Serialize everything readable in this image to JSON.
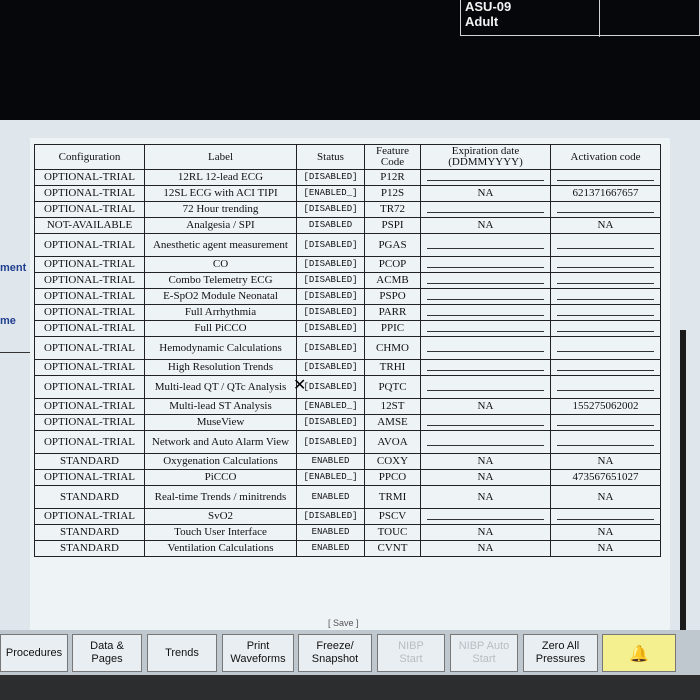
{
  "patient": {
    "bed": "ASU-09",
    "category": "Adult"
  },
  "left_panel": {
    "label_1": "ment",
    "label_2": "me"
  },
  "table": {
    "headers": [
      "Configuration",
      "Label",
      "Status",
      "Feature Code",
      "Expiration date (DDMMYYYY)",
      "Activation code"
    ],
    "rows": [
      {
        "config": "OPTIONAL-TRIAL",
        "label": "12RL 12-lead ECG",
        "status": "[DISABLED]",
        "code": "P12R",
        "exp": "",
        "act": ""
      },
      {
        "config": "OPTIONAL-TRIAL",
        "label": "12SL ECG with ACI TIPI",
        "status": "[ENABLED_]",
        "code": "P12S",
        "exp": "NA",
        "act": "621371667657"
      },
      {
        "config": "OPTIONAL-TRIAL",
        "label": "72 Hour trending",
        "status": "[DISABLED]",
        "code": "TR72",
        "exp": "",
        "act": ""
      },
      {
        "config": "NOT-AVAILABLE",
        "label": "Analgesia / SPI",
        "status": "DISABLED",
        "code": "PSPI",
        "exp": "NA",
        "act": "NA"
      },
      {
        "config": "OPTIONAL-TRIAL",
        "label": "Anesthetic agent measurement",
        "status": "[DISABLED]",
        "code": "PGAS",
        "exp": "",
        "act": ""
      },
      {
        "config": "OPTIONAL-TRIAL",
        "label": "CO",
        "status": "[DISABLED]",
        "code": "PCOP",
        "exp": "",
        "act": ""
      },
      {
        "config": "OPTIONAL-TRIAL",
        "label": "Combo Telemetry ECG",
        "status": "[DISABLED]",
        "code": "ACMB",
        "exp": "",
        "act": ""
      },
      {
        "config": "OPTIONAL-TRIAL",
        "label": "E-SpO2 Module Neonatal",
        "status": "[DISABLED]",
        "code": "PSPO",
        "exp": "",
        "act": ""
      },
      {
        "config": "OPTIONAL-TRIAL",
        "label": "Full Arrhythmia",
        "status": "[DISABLED]",
        "code": "PARR",
        "exp": "",
        "act": ""
      },
      {
        "config": "OPTIONAL-TRIAL",
        "label": "Full PiCCO",
        "status": "[DISABLED]",
        "code": "PPIC",
        "exp": "",
        "act": ""
      },
      {
        "config": "OPTIONAL-TRIAL",
        "label": "Hemodynamic Calculations",
        "status": "[DISABLED]",
        "code": "CHMO",
        "exp": "",
        "act": ""
      },
      {
        "config": "OPTIONAL-TRIAL",
        "label": "High Resolution Trends",
        "status": "[DISABLED]",
        "code": "TRHI",
        "exp": "",
        "act": ""
      },
      {
        "config": "OPTIONAL-TRIAL",
        "label": "Multi-lead QT / QTc Analysis",
        "status": "[DISABLED]",
        "code": "PQTC",
        "exp": "",
        "act": ""
      },
      {
        "config": "OPTIONAL-TRIAL",
        "label": "Multi-lead ST Analysis",
        "status": "[ENABLED_]",
        "code": "12ST",
        "exp": "NA",
        "act": "155275062002"
      },
      {
        "config": "OPTIONAL-TRIAL",
        "label": "MuseView",
        "status": "[DISABLED]",
        "code": "AMSE",
        "exp": "",
        "act": ""
      },
      {
        "config": "OPTIONAL-TRIAL",
        "label": "Network and Auto Alarm View",
        "status": "[DISABLED]",
        "code": "AVOA",
        "exp": "",
        "act": ""
      },
      {
        "config": "STANDARD",
        "label": "Oxygenation Calculations",
        "status": "ENABLED",
        "code": "COXY",
        "exp": "NA",
        "act": "NA"
      },
      {
        "config": "OPTIONAL-TRIAL",
        "label": "PiCCO",
        "status": "[ENABLED_]",
        "code": "PPCO",
        "exp": "NA",
        "act": "473567651027"
      },
      {
        "config": "STANDARD",
        "label": "Real-time Trends / minitrends",
        "status": "ENABLED",
        "code": "TRMI",
        "exp": "NA",
        "act": "NA"
      },
      {
        "config": "OPTIONAL-TRIAL",
        "label": "SvO2",
        "status": "[DISABLED]",
        "code": "PSCV",
        "exp": "",
        "act": ""
      },
      {
        "config": "STANDARD",
        "label": "Touch User Interface",
        "status": "ENABLED",
        "code": "TOUC",
        "exp": "NA",
        "act": "NA"
      },
      {
        "config": "STANDARD",
        "label": "Ventilation Calculations",
        "status": "ENABLED",
        "code": "CVNT",
        "exp": "NA",
        "act": "NA"
      }
    ]
  },
  "save_label": "[ Save ]",
  "taskbar": [
    {
      "name": "procedures-button",
      "label": "Procedures",
      "enabled": true
    },
    {
      "name": "data-pages-button",
      "label": "Data &\nPages",
      "enabled": true
    },
    {
      "name": "trends-button",
      "label": "Trends",
      "enabled": true
    },
    {
      "name": "print-waveforms-button",
      "label": "Print\nWaveforms",
      "enabled": true
    },
    {
      "name": "freeze-snapshot-button",
      "label": "Freeze/\nSnapshot",
      "enabled": true
    },
    {
      "name": "nibp-start-button",
      "label": "NIBP\nStart",
      "enabled": false
    },
    {
      "name": "nibp-auto-start-button",
      "label": "NIBP Auto\nStart",
      "enabled": false
    },
    {
      "name": "zero-all-pressures-button",
      "label": "Zero All\nPressures",
      "enabled": true
    },
    {
      "name": "alarm-silence-button",
      "label": "",
      "enabled": true
    }
  ],
  "colors": {
    "screen": "#dfe6ec",
    "taskbar": "#bfc8cf",
    "alarm": "#f5f08f"
  }
}
